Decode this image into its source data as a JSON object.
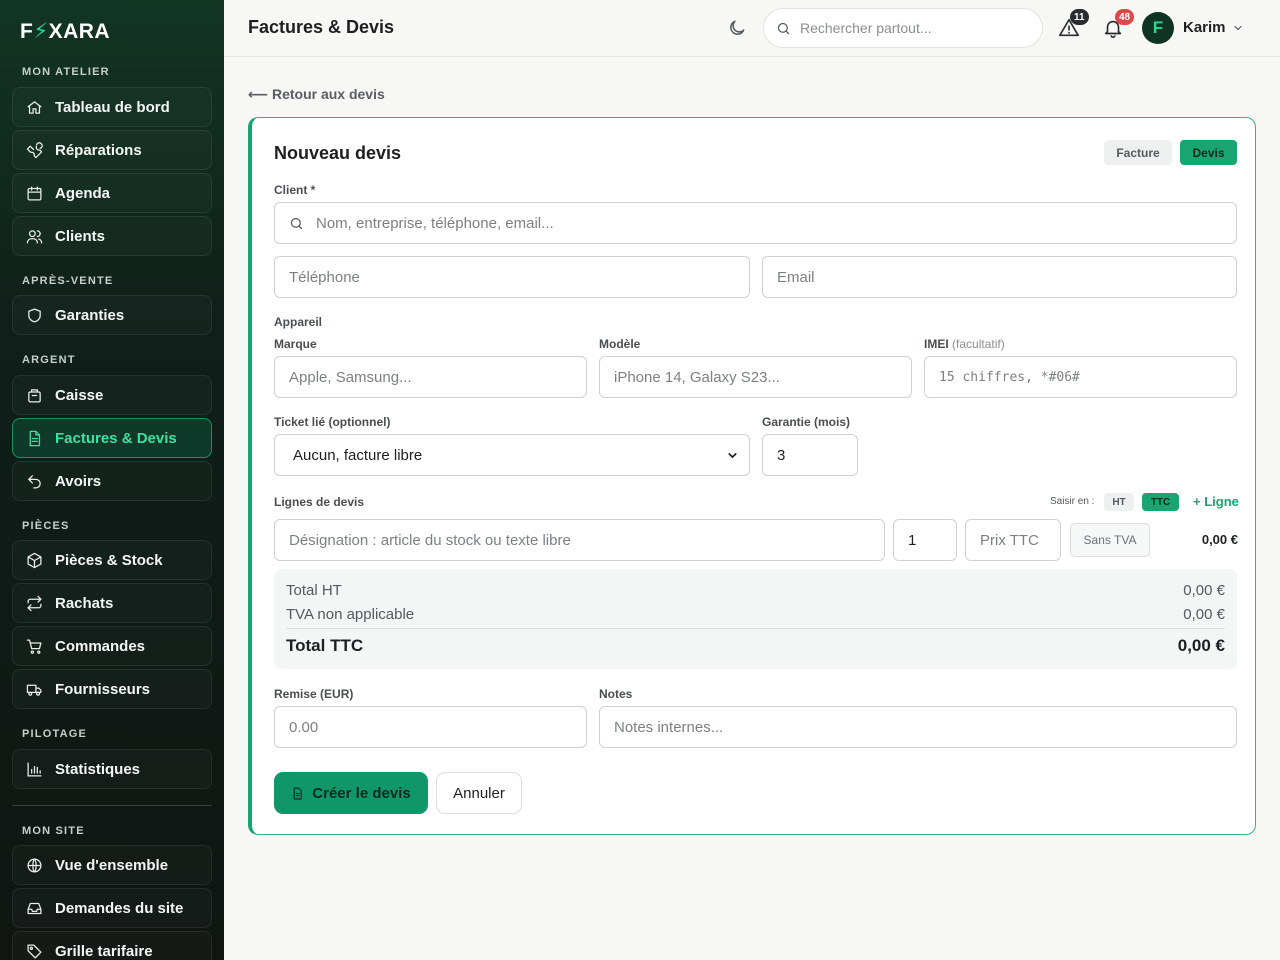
{
  "brand": {
    "logo_left": "F",
    "logo_right": "XARA",
    "accent": "#18a571"
  },
  "sidebar": {
    "sections": {
      "atelier": "MON ATELIER",
      "apres_vente": "APRÈS-VENTE",
      "argent": "ARGENT",
      "pieces": "PIÈCES",
      "pilotage": "PILOTAGE",
      "site": "MON SITE"
    },
    "items": [
      {
        "label": "Tableau de bord",
        "icon": "home-icon"
      },
      {
        "label": "Réparations",
        "icon": "wrench-icon"
      },
      {
        "label": "Agenda",
        "icon": "calendar-icon"
      },
      {
        "label": "Clients",
        "icon": "users-icon"
      },
      {
        "label": "Garanties",
        "icon": "shield-icon"
      },
      {
        "label": "Caisse",
        "icon": "cash-register-icon"
      },
      {
        "label": "Factures & Devis",
        "icon": "document-icon",
        "active": true
      },
      {
        "label": "Avoirs",
        "icon": "undo-icon"
      },
      {
        "label": "Pièces & Stock",
        "icon": "box-icon"
      },
      {
        "label": "Rachats",
        "icon": "exchange-icon"
      },
      {
        "label": "Commandes",
        "icon": "cart-icon"
      },
      {
        "label": "Fournisseurs",
        "icon": "truck-icon"
      },
      {
        "label": "Statistiques",
        "icon": "bar-chart-icon"
      },
      {
        "label": "Vue d'ensemble",
        "icon": "globe-icon"
      },
      {
        "label": "Demandes du site",
        "icon": "inbox-icon"
      },
      {
        "label": "Grille tarifaire",
        "icon": "tag-icon"
      }
    ]
  },
  "header": {
    "title": "Factures & Devis",
    "search_placeholder": "Rechercher partout...",
    "alerts_count": "11",
    "notifications_count": "48",
    "user_initial": "F",
    "user_name": "Karim"
  },
  "main": {
    "back_link": "⟵ Retour aux devis",
    "card_title": "Nouveau devis",
    "type_toggle": {
      "facture": "Facture",
      "devis": "Devis",
      "selected": "Devis"
    },
    "client_label": "Client *",
    "client_placeholder": "Nom, entreprise, téléphone, email...",
    "phone_placeholder": "Téléphone",
    "email_placeholder": "Email",
    "device_label": "Appareil",
    "brand_label": "Marque",
    "brand_placeholder": "Apple, Samsung...",
    "model_label": "Modèle",
    "model_placeholder": "iPhone 14, Galaxy S23...",
    "imei_label": "IMEI",
    "imei_optional": "(facultatif)",
    "imei_placeholder": "15 chiffres, *#06#",
    "ticket_label": "Ticket lié (optionnel)",
    "ticket_value": "Aucun, facture libre",
    "warranty_label": "Garantie (mois)",
    "warranty_value": "3",
    "lines_label": "Lignes de devis",
    "enter_in_label": "Saisir en :",
    "mode_ht": "HT",
    "mode_ttc": "TTC",
    "add_line": "+ Ligne",
    "line": {
      "designation_placeholder": "Désignation : article du stock ou texte libre",
      "qty": "1",
      "price_placeholder": "Prix TTC",
      "vat_option": "Sans TVA",
      "total": "0,00 €"
    },
    "totals": {
      "ht_label": "Total HT",
      "ht_value": "0,00 €",
      "vat_label": "TVA non applicable",
      "vat_value": "0,00 €",
      "ttc_label": "Total TTC",
      "ttc_value": "0,00 €"
    },
    "discount_label": "Remise (EUR)",
    "discount_placeholder": "0.00",
    "notes_label": "Notes",
    "notes_placeholder": "Notes internes...",
    "create_button": "Créer le devis",
    "cancel_button": "Annuler"
  }
}
